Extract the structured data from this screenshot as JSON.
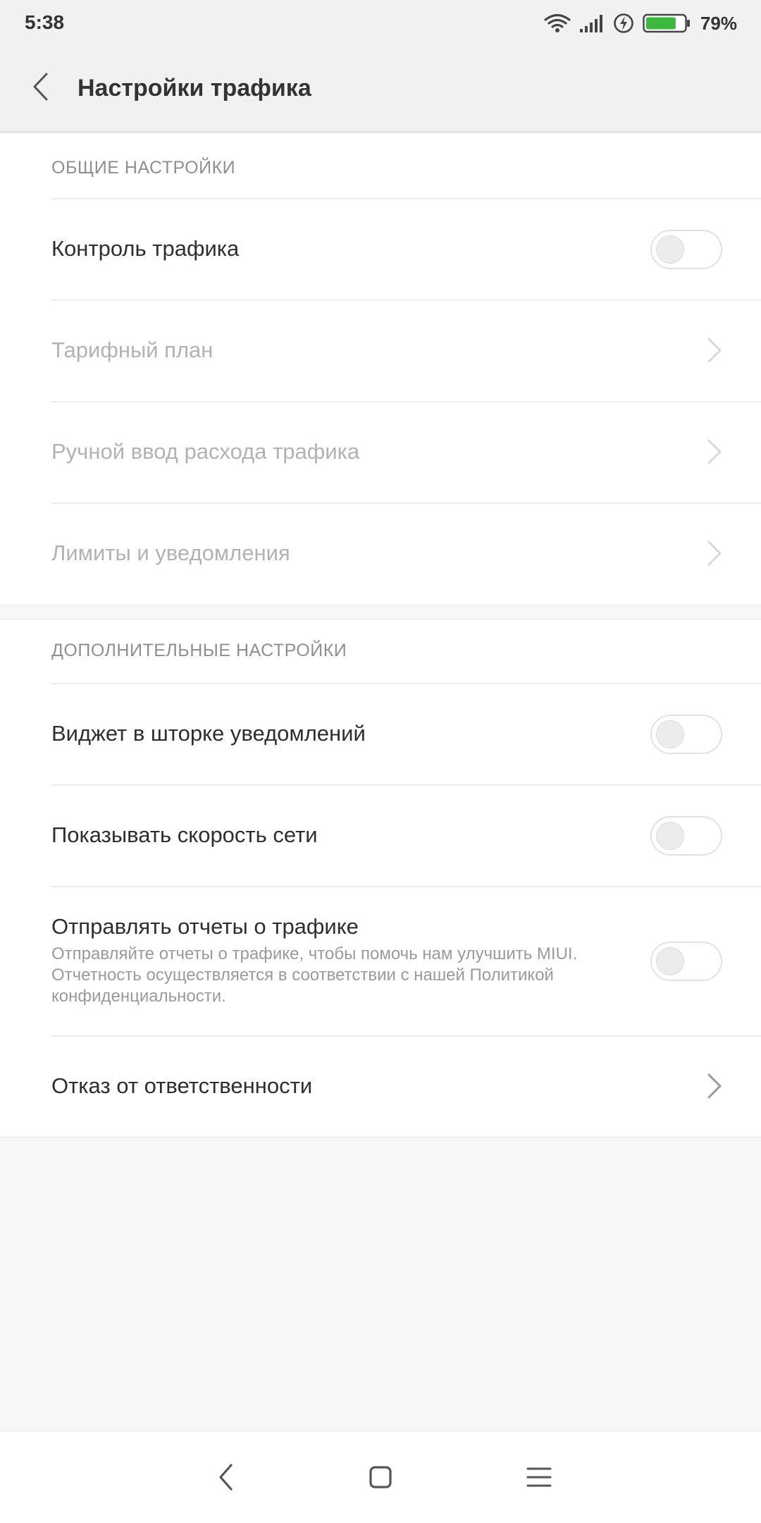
{
  "status_bar": {
    "time": "5:38",
    "battery_percent": "79%",
    "battery_level": 0.79,
    "battery_color": "#3cb83c"
  },
  "header": {
    "title": "Настройки трафика"
  },
  "general": {
    "header": "ОБЩИЕ НАСТРОЙКИ",
    "items": [
      {
        "label": "Контроль трафика",
        "type": "toggle",
        "on": false
      },
      {
        "label": "Тарифный план",
        "type": "link",
        "disabled": true
      },
      {
        "label": "Ручной ввод расхода трафика",
        "type": "link",
        "disabled": true
      },
      {
        "label": "Лимиты и уведомления",
        "type": "link",
        "disabled": true
      }
    ]
  },
  "additional": {
    "header": "ДОПОЛНИТЕЛЬНЫЕ НАСТРОЙКИ",
    "items": [
      {
        "label": "Виджет в шторке уведомлений",
        "type": "toggle",
        "on": false
      },
      {
        "label": "Показывать скорость сети",
        "type": "toggle",
        "on": false
      },
      {
        "label": "Отправлять отчеты о трафике",
        "summary": "Отправляйте отчеты о трафике, чтобы помочь нам улучшить MIUI. Отчетность осуществляется в соответствии с нашей Политикой конфиденциальности.",
        "type": "toggle",
        "on": false
      },
      {
        "label": "Отказ от ответственности",
        "type": "link",
        "disabled": false
      }
    ]
  },
  "icons": {
    "status": [
      "wifi-icon",
      "signal-icon",
      "charging-icon",
      "battery-icon"
    ],
    "nav": [
      "back-nav-icon",
      "home-nav-icon",
      "menu-nav-icon"
    ]
  }
}
